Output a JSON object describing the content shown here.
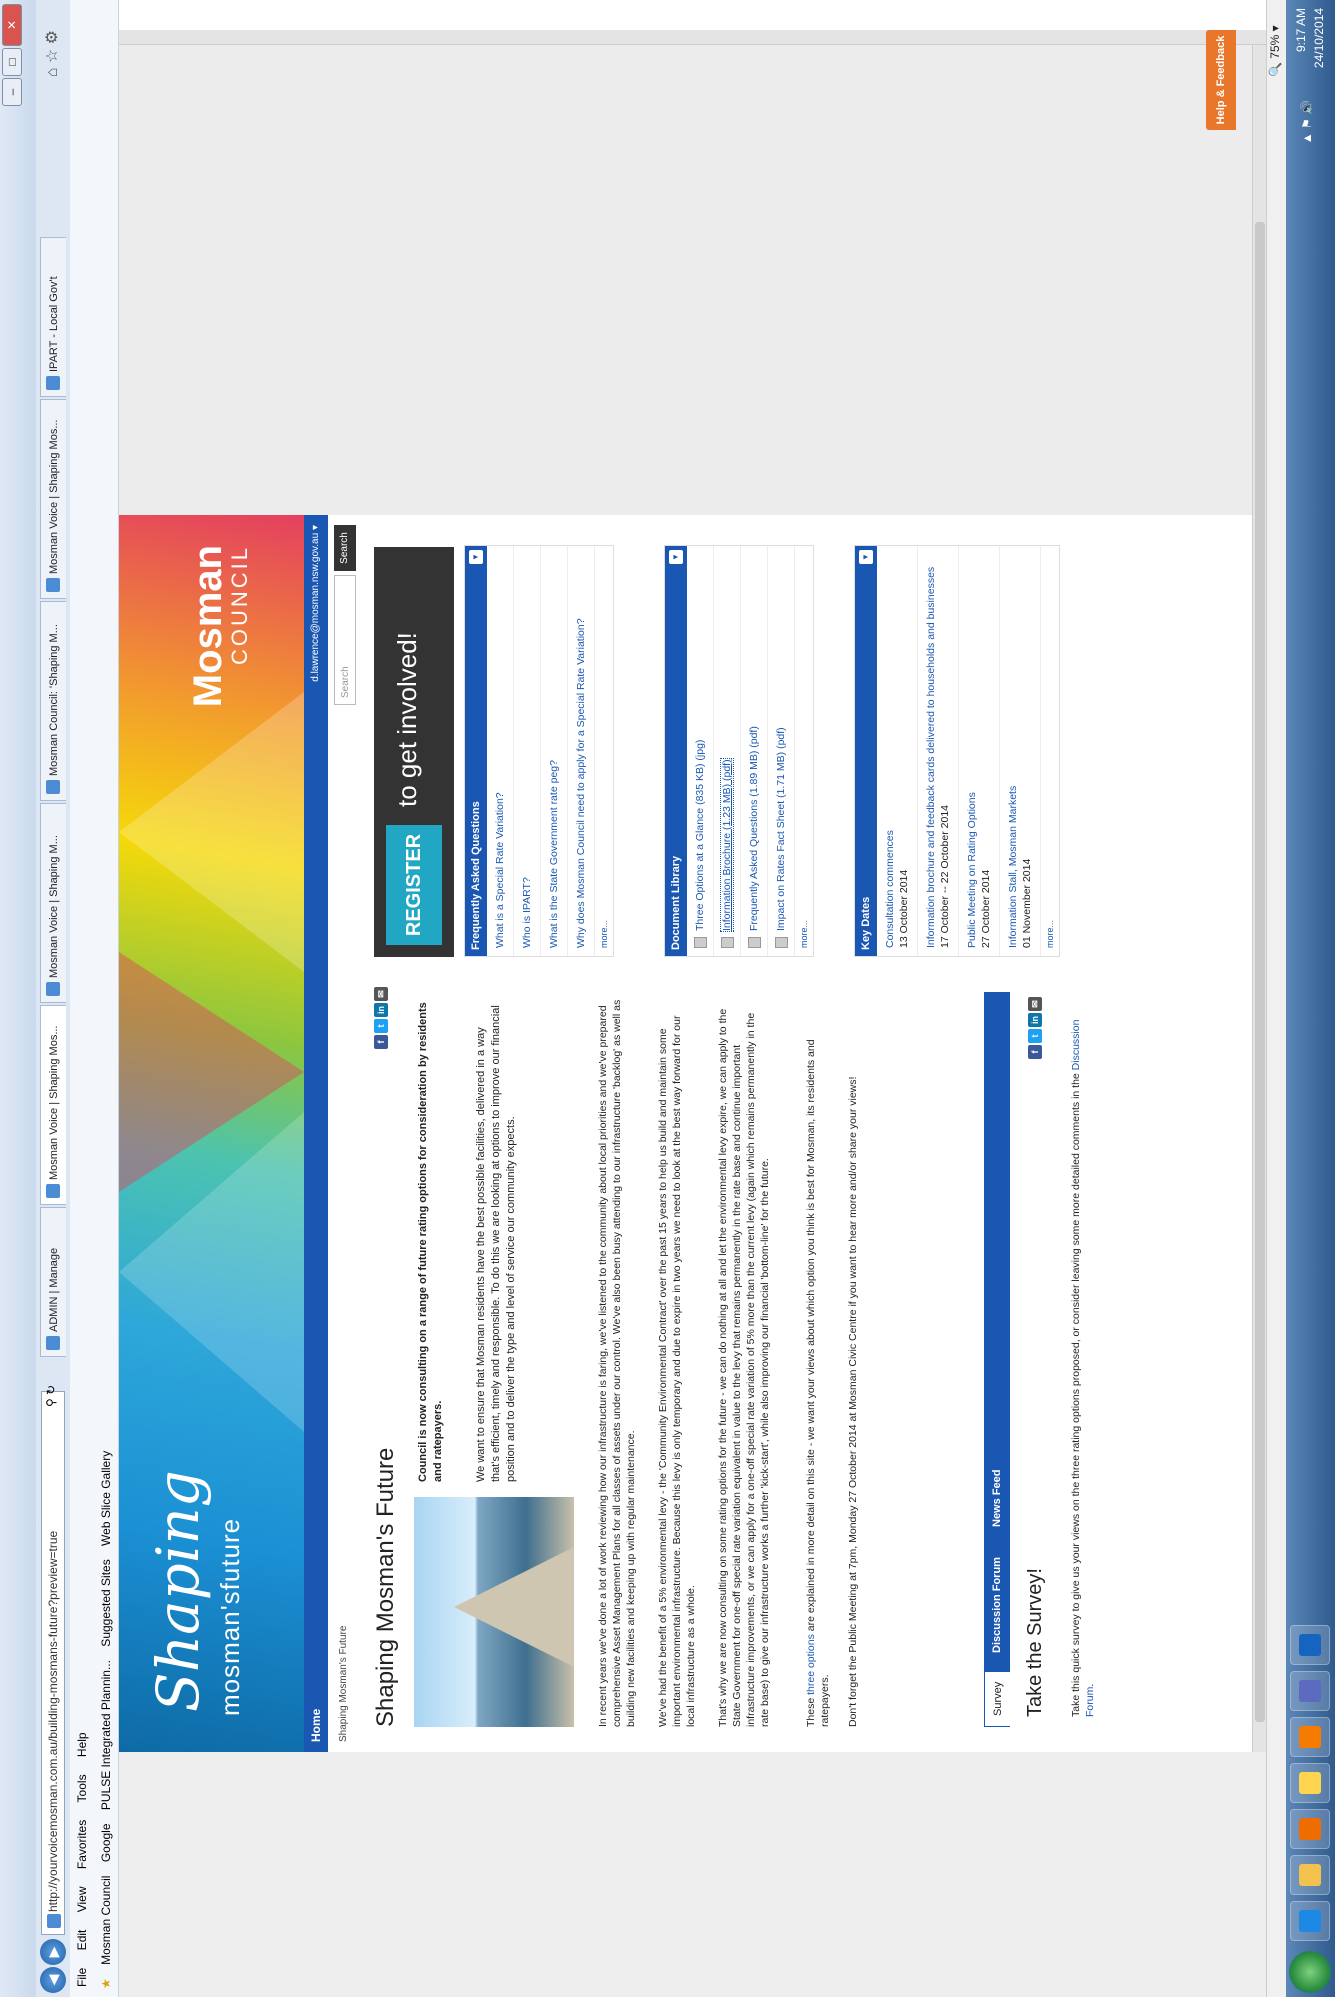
{
  "browser": {
    "address": "http://yourvoicemosman.com.au/building-mosmans-future?preview=true",
    "tabs": [
      "ADMIN | Manage",
      "Mosman Voice | Shaping Mos...",
      "Mosman Voice | Shaping M...",
      "Mosman Council: 'Shaping M...",
      "Mosman Voice | Shaping Mos...",
      "IPART - Local Gov't"
    ],
    "menu": [
      "File",
      "Edit",
      "View",
      "Favorites",
      "Tools",
      "Help"
    ],
    "favorites": [
      "Mosman Council",
      "Google",
      "PULSE Integrated Plannin...",
      "Suggested Sites",
      "Web Slice Gallery"
    ],
    "zoom": "75%",
    "help_feedback": "Help & Feedback"
  },
  "site": {
    "logo_line1": "Shaping",
    "logo_line2": "mosman'sfuture",
    "council_line1": "Mosman",
    "council_line2": "COUNCIL",
    "nav_home": "Home",
    "user": "d.lawrence@mosman.nsw.gov.au",
    "breadcrumb": "Shaping Mosman's Future",
    "search_placeholder": "Search",
    "search_button": "Search"
  },
  "main": {
    "title": "Shaping Mosman's Future",
    "intro_strong": "Council is now consulting on a range of future rating options for consideration by residents and ratepayers.",
    "intro_p2": "We want to ensure that Mosman residents have the best possible facilities, delivered in a way that's efficient, timely and responsible. To do this we are looking at options to improve our financial position and to deliver the type and level of service our community expects.",
    "p3": "In recent years we've done a lot of work reviewing how our infrastructure is faring, we've listened to the community about local priorities and we've prepared comprehensive Asset Management Plans for all classes of assets under our control. We've also been busy attending to our infrastructure 'backlog' as well as building new facilities and keeping up with regular maintenance.",
    "p4": "We've had the benefit of a 5% environmental levy - the 'Community Environmental Contract' over the past 15 years to help us build and maintain some important environmental infrastructure. Because this levy is only temporary and due to expire in two years we need to look at the best way forward for our local infrastructure as a whole.",
    "p5": "That's why we are now consulting on some rating options for the future - we can do nothing at all and let the environmental levy expire, we can apply to the State Government for one-off special rate variation equivalent in value to the levy that remains permanently in the rate base and continue important infrastructure improvements, or we can apply for a one-off special rate variation of 5% more than the current levy (again which remains permanently in the rate base) to give our infrastructure works a further 'kick-start', while also improving our financial 'bottom-line' for the future.",
    "p6_before": "These ",
    "p6_link": "three options",
    "p6_after": " are explained in more detail on this site - we want your views about which option you think is best for Mosman, its residents and ratepayers.",
    "p7": "Don't forget the Public Meeting at 7pm, Monday 27 October 2014 at Mosman Civic Centre if you want to hear more and/or share your views!",
    "tabs": [
      "Survey",
      "Discussion Forum",
      "News Feed"
    ],
    "survey_title": "Take the Survey!",
    "survey_text_before": "Take this quick survey to give us your views on the three rating options proposed, or consider leaving some more detailed comments in the ",
    "survey_text_link": "Discussion Forum",
    "survey_text_after": "."
  },
  "sidebar": {
    "register_button": "REGISTER",
    "register_text": "to get involved!",
    "faq_title": "Frequently Asked Questions",
    "faq": [
      "What is a Special Rate Variation?",
      "Who is IPART?",
      "What is the State Government rate peg?",
      "Why does Mosman Council need to apply for a Special Rate Variation?"
    ],
    "doc_title": "Document Library",
    "docs": [
      "Three Options at a Glance (835 KB) (jpg)",
      "Information Brochure (1.23 MB) (pdf)",
      "Frequently Asked Questions (1.89 MB) (pdf)",
      "Impact on Rates Fact Sheet (1.71 MB) (pdf)"
    ],
    "dates_title": "Key Dates",
    "dates": [
      {
        "label": "Consultation commences",
        "date": "13 October 2014"
      },
      {
        "label": "Information brochure and feedback cards delivered to households and businesses",
        "date": "17 October -- 22 October 2014"
      },
      {
        "label": "Public Meeting on Rating Options",
        "date": "27 October 2014"
      },
      {
        "label": "Information Stall, Mosman Markets",
        "date": "01 November 2014"
      }
    ],
    "more": "more..."
  },
  "taskbar": {
    "time": "9:17 AM",
    "date": "24/10/2014"
  }
}
